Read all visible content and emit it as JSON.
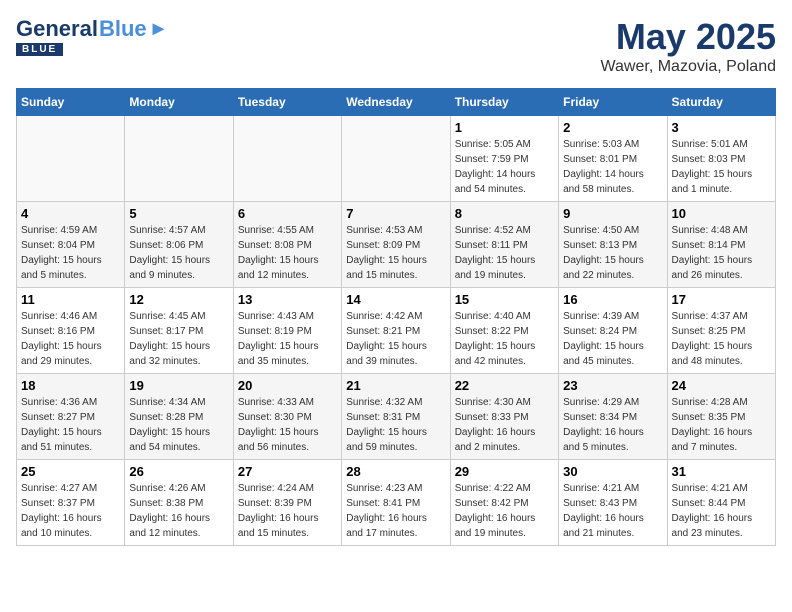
{
  "logo": {
    "general": "General",
    "blue": "Blue"
  },
  "header": {
    "month": "May 2025",
    "location": "Wawer, Mazovia, Poland"
  },
  "columns": [
    "Sunday",
    "Monday",
    "Tuesday",
    "Wednesday",
    "Thursday",
    "Friday",
    "Saturday"
  ],
  "weeks": [
    [
      {
        "day": "",
        "info": ""
      },
      {
        "day": "",
        "info": ""
      },
      {
        "day": "",
        "info": ""
      },
      {
        "day": "",
        "info": ""
      },
      {
        "day": "1",
        "info": "Sunrise: 5:05 AM\nSunset: 7:59 PM\nDaylight: 14 hours\nand 54 minutes."
      },
      {
        "day": "2",
        "info": "Sunrise: 5:03 AM\nSunset: 8:01 PM\nDaylight: 14 hours\nand 58 minutes."
      },
      {
        "day": "3",
        "info": "Sunrise: 5:01 AM\nSunset: 8:03 PM\nDaylight: 15 hours\nand 1 minute."
      }
    ],
    [
      {
        "day": "4",
        "info": "Sunrise: 4:59 AM\nSunset: 8:04 PM\nDaylight: 15 hours\nand 5 minutes."
      },
      {
        "day": "5",
        "info": "Sunrise: 4:57 AM\nSunset: 8:06 PM\nDaylight: 15 hours\nand 9 minutes."
      },
      {
        "day": "6",
        "info": "Sunrise: 4:55 AM\nSunset: 8:08 PM\nDaylight: 15 hours\nand 12 minutes."
      },
      {
        "day": "7",
        "info": "Sunrise: 4:53 AM\nSunset: 8:09 PM\nDaylight: 15 hours\nand 15 minutes."
      },
      {
        "day": "8",
        "info": "Sunrise: 4:52 AM\nSunset: 8:11 PM\nDaylight: 15 hours\nand 19 minutes."
      },
      {
        "day": "9",
        "info": "Sunrise: 4:50 AM\nSunset: 8:13 PM\nDaylight: 15 hours\nand 22 minutes."
      },
      {
        "day": "10",
        "info": "Sunrise: 4:48 AM\nSunset: 8:14 PM\nDaylight: 15 hours\nand 26 minutes."
      }
    ],
    [
      {
        "day": "11",
        "info": "Sunrise: 4:46 AM\nSunset: 8:16 PM\nDaylight: 15 hours\nand 29 minutes."
      },
      {
        "day": "12",
        "info": "Sunrise: 4:45 AM\nSunset: 8:17 PM\nDaylight: 15 hours\nand 32 minutes."
      },
      {
        "day": "13",
        "info": "Sunrise: 4:43 AM\nSunset: 8:19 PM\nDaylight: 15 hours\nand 35 minutes."
      },
      {
        "day": "14",
        "info": "Sunrise: 4:42 AM\nSunset: 8:21 PM\nDaylight: 15 hours\nand 39 minutes."
      },
      {
        "day": "15",
        "info": "Sunrise: 4:40 AM\nSunset: 8:22 PM\nDaylight: 15 hours\nand 42 minutes."
      },
      {
        "day": "16",
        "info": "Sunrise: 4:39 AM\nSunset: 8:24 PM\nDaylight: 15 hours\nand 45 minutes."
      },
      {
        "day": "17",
        "info": "Sunrise: 4:37 AM\nSunset: 8:25 PM\nDaylight: 15 hours\nand 48 minutes."
      }
    ],
    [
      {
        "day": "18",
        "info": "Sunrise: 4:36 AM\nSunset: 8:27 PM\nDaylight: 15 hours\nand 51 minutes."
      },
      {
        "day": "19",
        "info": "Sunrise: 4:34 AM\nSunset: 8:28 PM\nDaylight: 15 hours\nand 54 minutes."
      },
      {
        "day": "20",
        "info": "Sunrise: 4:33 AM\nSunset: 8:30 PM\nDaylight: 15 hours\nand 56 minutes."
      },
      {
        "day": "21",
        "info": "Sunrise: 4:32 AM\nSunset: 8:31 PM\nDaylight: 15 hours\nand 59 minutes."
      },
      {
        "day": "22",
        "info": "Sunrise: 4:30 AM\nSunset: 8:33 PM\nDaylight: 16 hours\nand 2 minutes."
      },
      {
        "day": "23",
        "info": "Sunrise: 4:29 AM\nSunset: 8:34 PM\nDaylight: 16 hours\nand 5 minutes."
      },
      {
        "day": "24",
        "info": "Sunrise: 4:28 AM\nSunset: 8:35 PM\nDaylight: 16 hours\nand 7 minutes."
      }
    ],
    [
      {
        "day": "25",
        "info": "Sunrise: 4:27 AM\nSunset: 8:37 PM\nDaylight: 16 hours\nand 10 minutes."
      },
      {
        "day": "26",
        "info": "Sunrise: 4:26 AM\nSunset: 8:38 PM\nDaylight: 16 hours\nand 12 minutes."
      },
      {
        "day": "27",
        "info": "Sunrise: 4:24 AM\nSunset: 8:39 PM\nDaylight: 16 hours\nand 15 minutes."
      },
      {
        "day": "28",
        "info": "Sunrise: 4:23 AM\nSunset: 8:41 PM\nDaylight: 16 hours\nand 17 minutes."
      },
      {
        "day": "29",
        "info": "Sunrise: 4:22 AM\nSunset: 8:42 PM\nDaylight: 16 hours\nand 19 minutes."
      },
      {
        "day": "30",
        "info": "Sunrise: 4:21 AM\nSunset: 8:43 PM\nDaylight: 16 hours\nand 21 minutes."
      },
      {
        "day": "31",
        "info": "Sunrise: 4:21 AM\nSunset: 8:44 PM\nDaylight: 16 hours\nand 23 minutes."
      }
    ]
  ]
}
